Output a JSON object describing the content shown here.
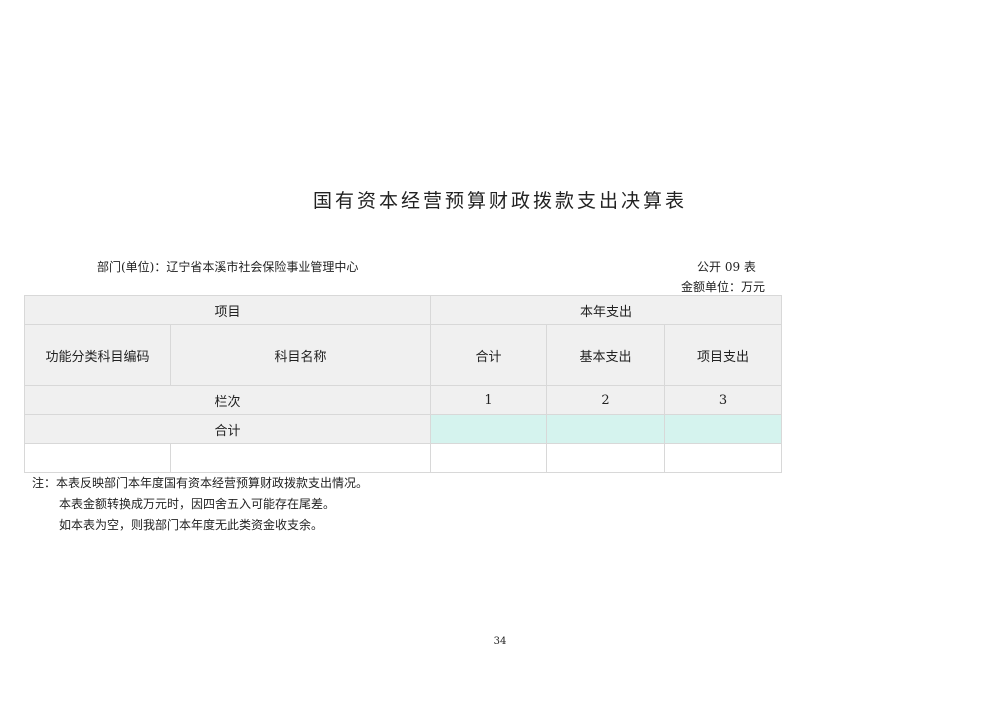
{
  "title": "国有资本经营预算财政拨款支出决算表",
  "department": "部门(单位)：辽宁省本溪市社会保险事业管理中心",
  "form_no": "公开 09 表",
  "unit": "金额单位：万元",
  "table": {
    "header_project": "项目",
    "header_current_year": "本年支出",
    "col_code": "功能分类科目编码",
    "col_name": "科目名称",
    "col_total": "合计",
    "col_basic": "基本支出",
    "col_project": "项目支出",
    "row_index_label": "栏次",
    "index_1": "1",
    "index_2": "2",
    "index_3": "3",
    "total_label": "合计"
  },
  "notes": [
    "注：本表反映部门本年度国有资本经营预算财政拨款支出情况。",
    "本表金额转换成万元时，因四舍五入可能存在尾差。",
    "如本表为空，则我部门本年度无此类资金收支余。"
  ],
  "page_number": "34"
}
